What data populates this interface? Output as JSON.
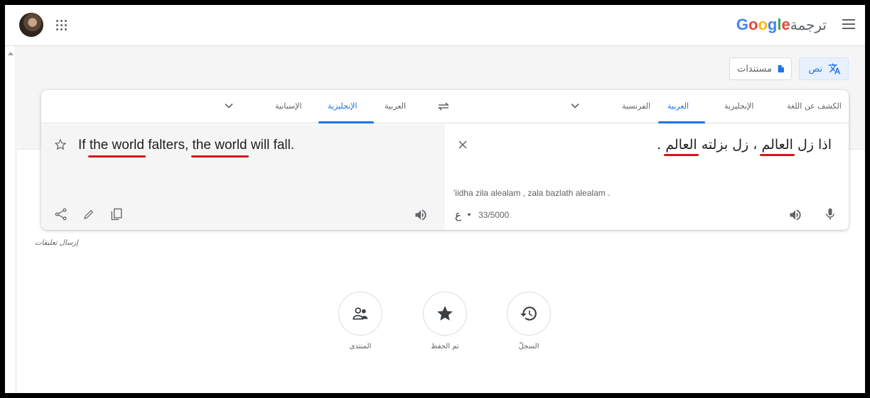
{
  "header": {
    "brand_google": "Google",
    "brand_translate": "ترجمة",
    "brand_colors": [
      "#4285f4",
      "#ea4335",
      "#fbbc05",
      "#4285f4",
      "#34a853",
      "#ea4335"
    ]
  },
  "modes": {
    "text_label": "نص",
    "documents_label": "مستندات"
  },
  "source_langs": {
    "detect": "الكشف عن اللغة",
    "english": "الإنجليزية",
    "arabic": "العربية",
    "french": "الفرنسية"
  },
  "target_langs": {
    "arabic": "العربية",
    "english": "الإنجليزية",
    "spanish": "الإسبانية"
  },
  "source": {
    "text_parts": [
      "اذا زل ",
      "العالم",
      " ، زل بزلته ",
      "العالم",
      " ."
    ],
    "transliteration": "'iidha zila alealam , zala bazlath alealam .",
    "ime_glyph": "ع",
    "char_count": "33/5000"
  },
  "target": {
    "text_parts": [
      "If ",
      "the world",
      " falters, ",
      "the world",
      " will fall."
    ]
  },
  "feedback_label": "إرسال تعليقات",
  "bottom_buttons": [
    {
      "label": "السجلّ",
      "icon": "history-icon"
    },
    {
      "label": "تم الحفظ",
      "icon": "star-icon"
    },
    {
      "label": "المنتدى",
      "icon": "community-icon"
    }
  ],
  "colors": {
    "accent": "#1a73e8",
    "underline": "#d0161b"
  }
}
